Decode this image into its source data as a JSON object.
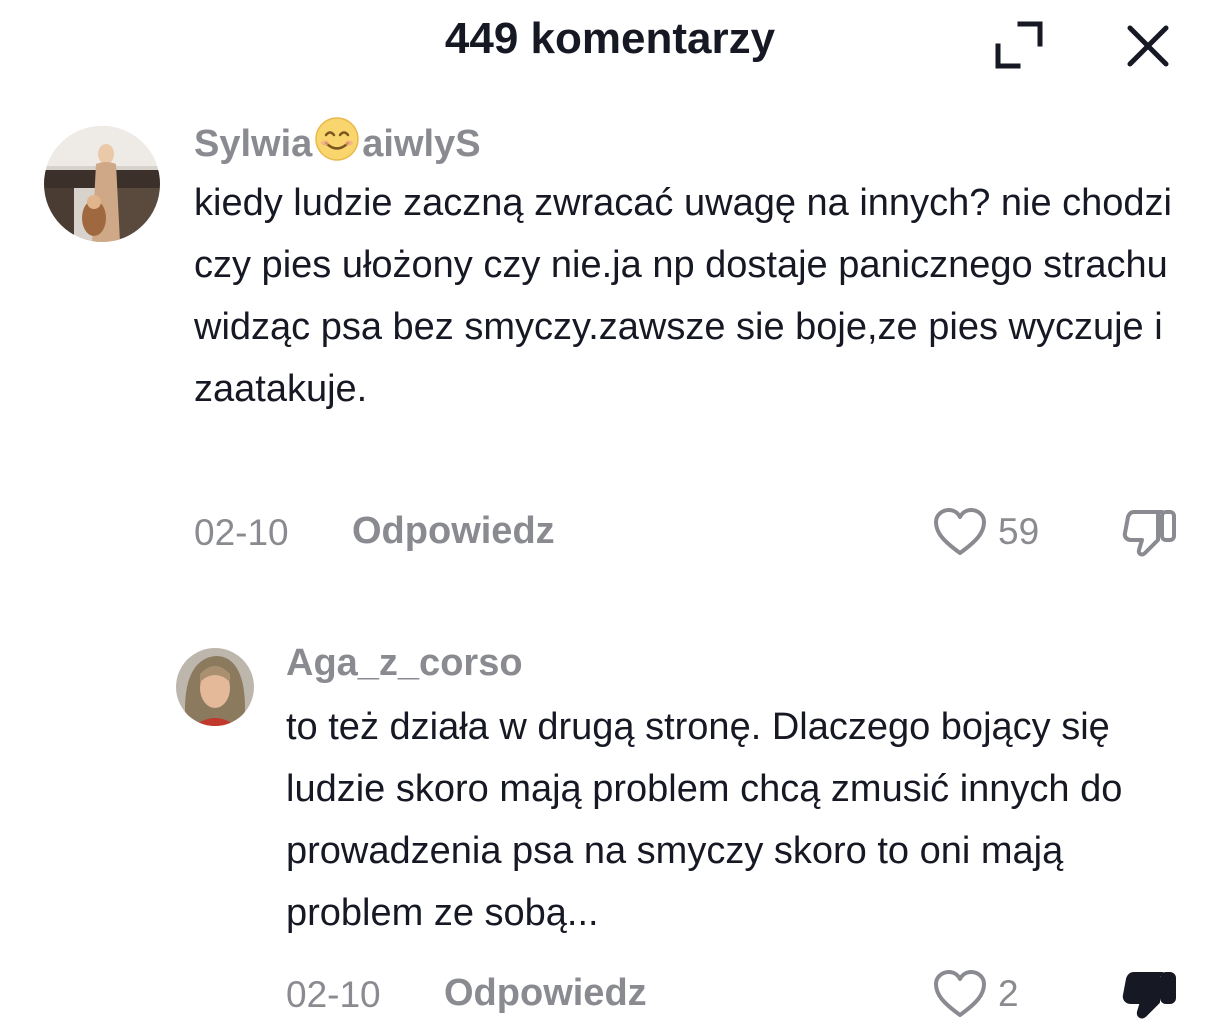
{
  "header": {
    "title": "449 komentarzy",
    "expand_icon": "expand-icon",
    "close_icon": "close-icon"
  },
  "comments": [
    {
      "username_part1": "Sylwia",
      "username_emoji": "smiling-face-emoji",
      "username_part2": "aiwlyS",
      "text": "kiedy ludzie zaczną zwracać uwagę na innych? nie chodzi czy pies ułożony czy nie.ja np dostaje panicznego strachu widząc psa bez smyczy.zawsze sie boje,ze pies wyczuje i zaatakuje.",
      "date": "02-10",
      "reply_label": "Odpowiedz",
      "likes": "59",
      "disliked": false
    },
    {
      "username": "Aga_z_corso",
      "text": "to też działa w drugą stronę. Dlaczego bojący się ludzie skoro mają problem chcą zmusić innych do prowadzenia psa na smyczy skoro to oni mają problem ze sobą...",
      "date": "02-10",
      "reply_label": "Odpowiedz",
      "likes": "2",
      "disliked": true
    }
  ],
  "colors": {
    "text": "#161823",
    "muted": "#8a8b91"
  }
}
